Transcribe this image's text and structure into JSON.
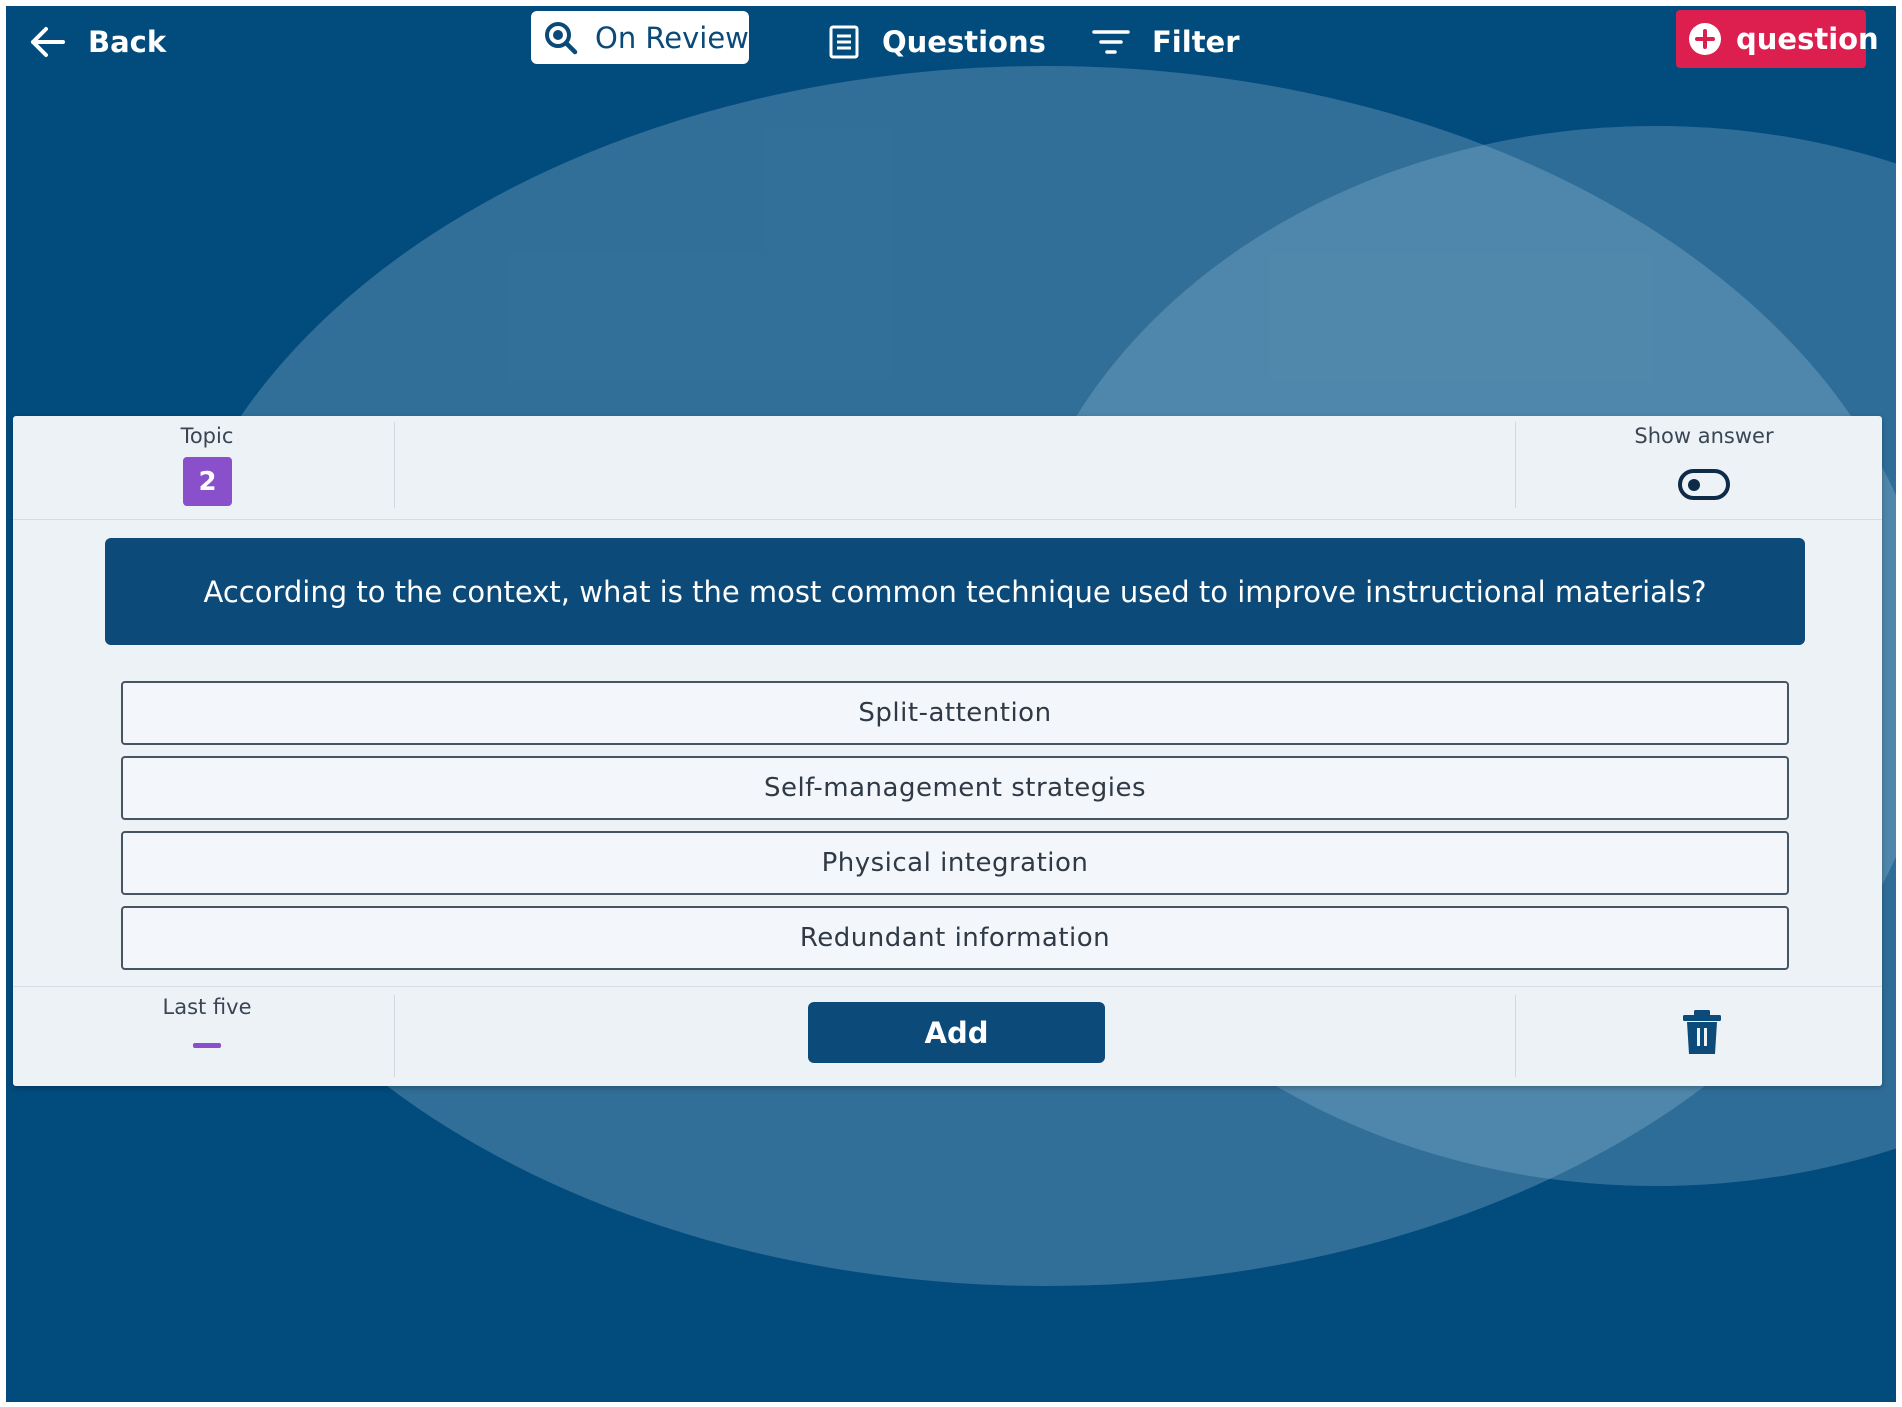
{
  "nav": {
    "back_label": "Back",
    "on_review_label": "On Review",
    "questions_label": "Questions",
    "filter_label": "Filter",
    "add_question_label": "question"
  },
  "card": {
    "topic_label": "Topic",
    "topic_number": "2",
    "show_answer_label": "Show answer",
    "show_answer_on": false,
    "question": "According to the context, what is the most common technique used to improve instructional materials?",
    "options": [
      "Split-attention",
      "Self-management strategies",
      "Physical integration",
      "Redundant information"
    ],
    "last_five_label": "Last five",
    "add_button_label": "Add"
  },
  "colors": {
    "background": "#024b7d",
    "accent": "#dc1f4f",
    "topic_badge": "#8a4fcb",
    "question_box": "#0c4a79"
  },
  "icons": {
    "back": "arrow-left-icon",
    "review": "search-icon",
    "questions": "document-icon",
    "filter": "filter-icon",
    "add": "plus-circle-icon",
    "delete": "trash-icon"
  }
}
